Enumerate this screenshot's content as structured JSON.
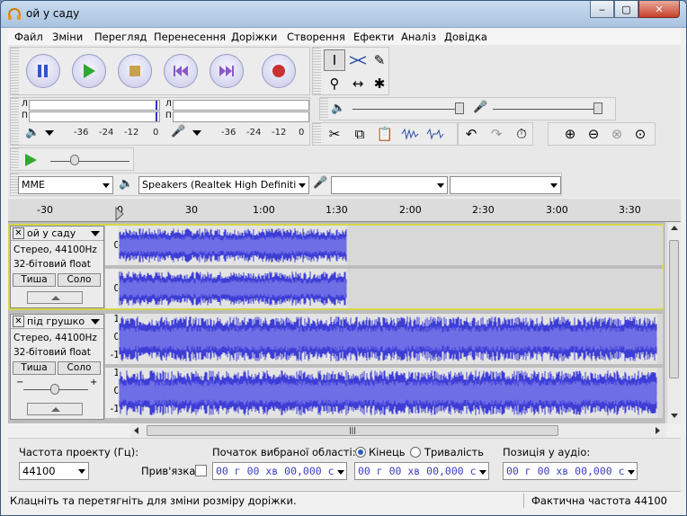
{
  "window": {
    "title": "ой у саду",
    "minimize": "‒",
    "maximize": "▢",
    "close": "✕"
  },
  "menu": [
    "Файл",
    "Зміни",
    "Перегляд",
    "Перенесення",
    "Доріжки",
    "Створення",
    "Ефекти",
    "Аналіз",
    "Довідка"
  ],
  "transport": {
    "pause": "pause-icon",
    "play": "play-icon",
    "stop": "stop-icon",
    "skip_start": "skip-start-icon",
    "skip_end": "skip-end-icon",
    "record": "record-icon"
  },
  "meters": {
    "left": "Л",
    "right": "П",
    "play_scale": [
      "-36",
      "-24",
      "-12",
      "0"
    ],
    "rec_scale": [
      "-36",
      "-24",
      "-12",
      "0"
    ]
  },
  "device": {
    "host": "MME",
    "output": "Speakers (Realtek High Definiti",
    "input": "",
    "channels": ""
  },
  "ruler": [
    "-30",
    "0",
    "30",
    "1:00",
    "1:30",
    "2:00",
    "2:30",
    "3:00",
    "3:30"
  ],
  "tracks": [
    {
      "name": "ой у саду",
      "format": "Стерео, 44100Hz",
      "bits": "32-бітовий float",
      "mute": "Тиша",
      "solo": "Соло",
      "scale_a": [
        "0-"
      ],
      "scale_b": [
        "0-"
      ],
      "duration_fraction": 0.42,
      "selected": true
    },
    {
      "name": "під грушко",
      "format": "Стерео, 44100Hz",
      "bits": "32-бітовий float",
      "mute": "Тиша",
      "solo": "Соло",
      "scale_a": [
        "1",
        "0-",
        "-1"
      ],
      "scale_b": [
        "1",
        "0-",
        "-1"
      ],
      "duration_fraction": 0.99,
      "selected": false
    }
  ],
  "scroll": {
    "grip": "|||"
  },
  "selection": {
    "rate_label": "Частота проекту (Гц):",
    "rate_value": "44100",
    "snap_label": "Прив'язка",
    "start_label": "Початок вибраної області:",
    "end_label": "Кінець",
    "length_label": "Тривалість",
    "position_label": "Позиція у аудіо:",
    "start_time": "00 г 00 хв 00,000 с",
    "end_time": "00 г 00 хв 00,000 с",
    "pos_time": "00 г 00 хв 00,000 с"
  },
  "status": {
    "message": "Клацніть та перетягніть для зміни розміру доріжки.",
    "rate": "Фактична частота 44100"
  },
  "colors": {
    "wave": "#3d3dd6",
    "wave_light": "#6e6ee6",
    "selected_border": "#d6d64a"
  }
}
